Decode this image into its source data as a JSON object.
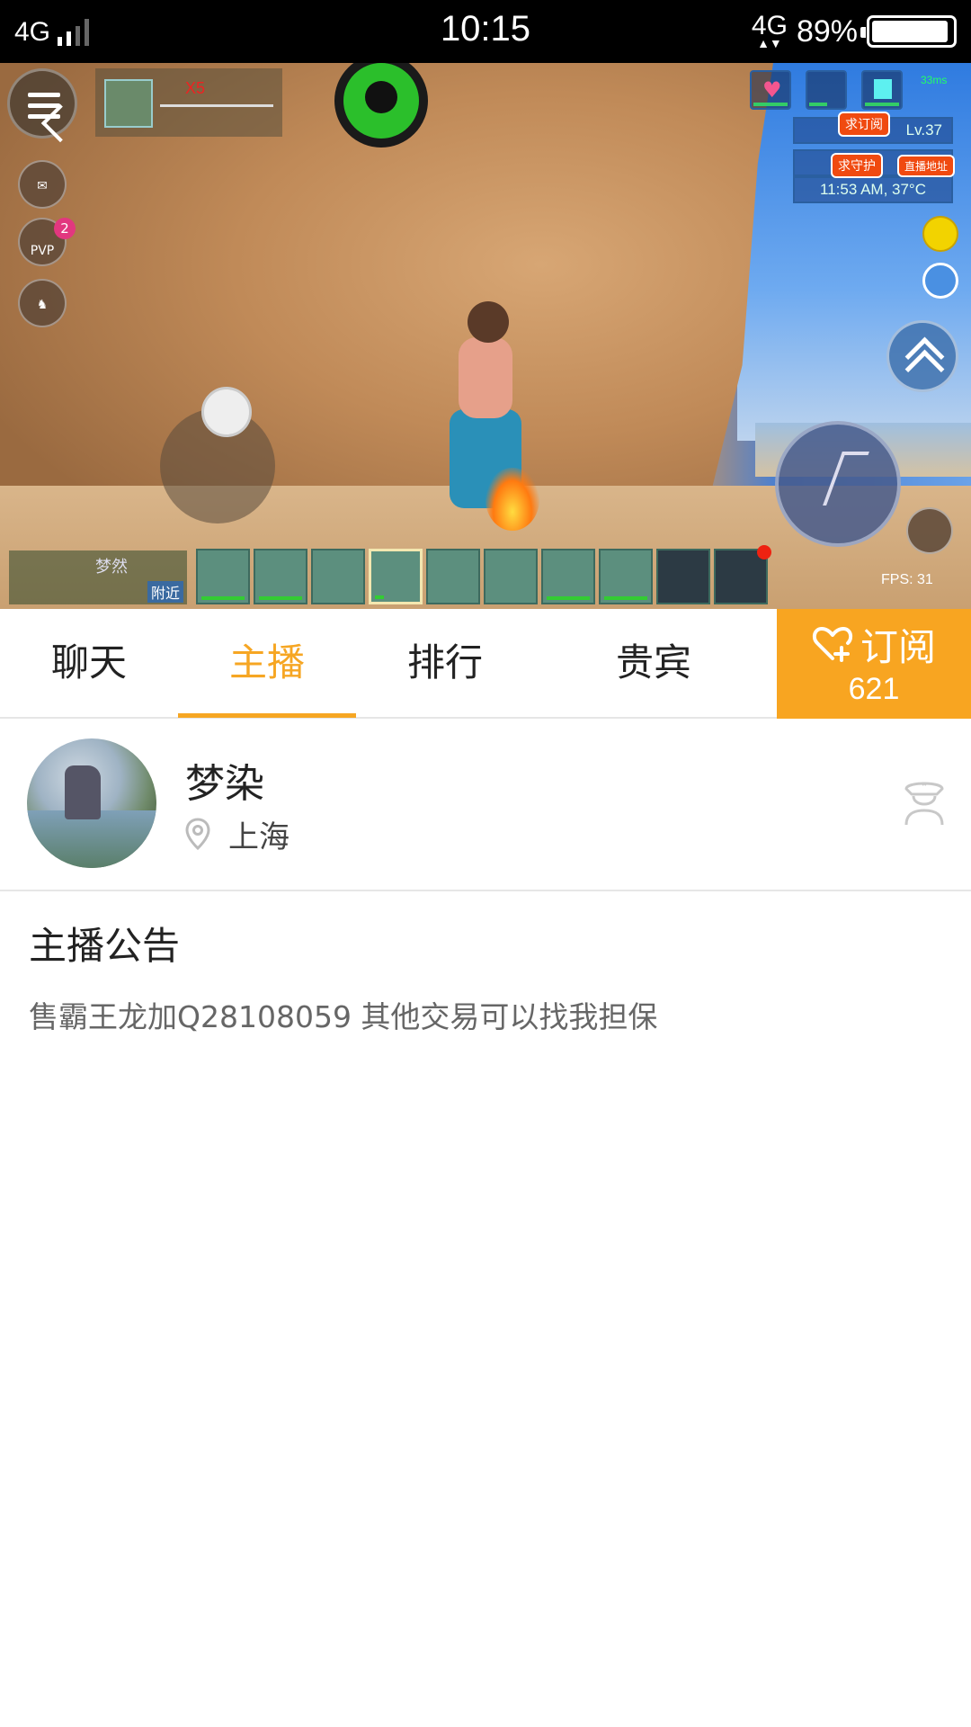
{
  "status_bar": {
    "network_left": "4G",
    "time": "10:15",
    "network_right": "4G",
    "battery_percent": "89%",
    "battery_level": 0.89
  },
  "game_hud": {
    "item_count": "X5",
    "player_level": "Lv.37",
    "game_time_temp": "11:53 AM, 37°C",
    "ping": "33ms",
    "pvp_label": "PVP",
    "pvp_badge": "2",
    "fps": "FPS: 31",
    "nearby_player": "梦然",
    "nearby_label": "附近",
    "tag_subscribe": "求订阅",
    "tag_guard": "求守护",
    "tag_stream": "直播地址",
    "icons": [
      "menu-icon",
      "mail-icon",
      "pvp-icon",
      "horse-icon",
      "heart-icon",
      "fish-icon",
      "water-icon",
      "wifi-icon",
      "smile-icon",
      "chat-icon"
    ]
  },
  "tabs": [
    {
      "label": "聊天",
      "active": false
    },
    {
      "label": "主播",
      "active": true
    },
    {
      "label": "排行",
      "active": false
    },
    {
      "label": "贵宾",
      "active": false
    }
  ],
  "subscribe": {
    "label": "订阅",
    "count": "621"
  },
  "profile": {
    "name": "梦染",
    "location": "上海"
  },
  "announcement": {
    "title": "主播公告",
    "body": "售霸王龙加Q28108059 其他交易可以找我担保"
  },
  "colors": {
    "accent": "#f6a623",
    "subscribe_bg": "#f8a521"
  }
}
